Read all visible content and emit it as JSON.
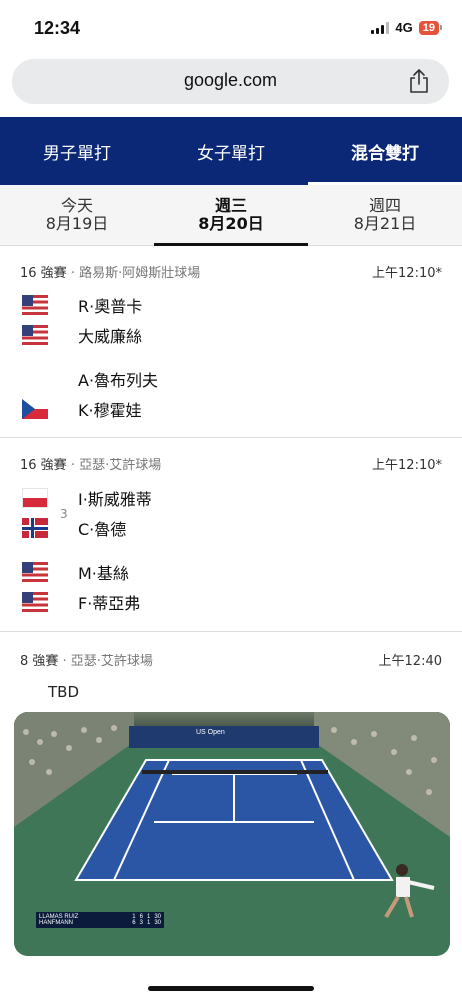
{
  "status": {
    "time": "12:34",
    "network": "4G",
    "battery": "19"
  },
  "browser": {
    "url": "google.com"
  },
  "category_tabs": [
    {
      "label": "男子單打",
      "active": false
    },
    {
      "label": "女子單打",
      "active": false
    },
    {
      "label": "混合雙打",
      "active": true
    }
  ],
  "date_tabs": [
    {
      "day": "今天",
      "date": "8月19日",
      "active": false
    },
    {
      "day": "週三",
      "date": "8月20日",
      "active": true
    },
    {
      "day": "週四",
      "date": "8月21日",
      "active": false
    }
  ],
  "matches": [
    {
      "round": "16 強賽",
      "venue": " · 路易斯·阿姆斯壯球場",
      "time": "上午12:10*",
      "players": [
        {
          "name": "R·奧普卡",
          "flag": "us-flag"
        },
        {
          "name": "大威廉絲",
          "flag": "us-flag"
        },
        {
          "name": "A·魯布列夫",
          "flag": "none"
        },
        {
          "name": "K·穆霍娃",
          "flag": "czech-flag"
        }
      ]
    },
    {
      "round": "16 強賽",
      "venue": " · 亞瑟·艾許球場",
      "time": "上午12:10*",
      "seed": "3",
      "players": [
        {
          "name": "I·斯威雅蒂",
          "flag": "poland-flag"
        },
        {
          "name": "C·魯德",
          "flag": "norway-flag"
        },
        {
          "name": "M·基絲",
          "flag": "us-flag"
        },
        {
          "name": "F·蒂亞弗",
          "flag": "us-flag"
        }
      ]
    },
    {
      "round": "8 強賽",
      "venue": " · 亞瑟·艾許球場",
      "time": "上午12:40",
      "tbd": "TBD"
    }
  ],
  "video": {
    "scoreboard": [
      {
        "name": "LLAMAS RUIZ",
        "scores": [
          "1",
          "6",
          "1",
          "30"
        ]
      },
      {
        "name": "HANFMANN",
        "scores": [
          "6",
          "3",
          "1",
          "30"
        ]
      }
    ],
    "banner_text": "US Open"
  }
}
